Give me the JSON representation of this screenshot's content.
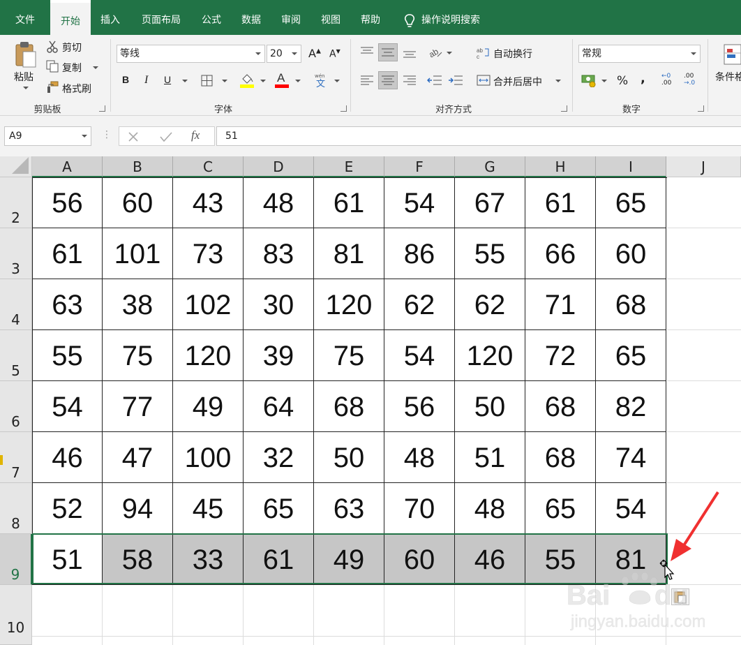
{
  "menu": {
    "tabs": [
      "文件",
      "开始",
      "插入",
      "页面布局",
      "公式",
      "数据",
      "审阅",
      "视图",
      "帮助"
    ],
    "search": "操作说明搜索"
  },
  "ribbon": {
    "clipboard": {
      "paste": "粘贴",
      "cut": "剪切",
      "copy": "复制",
      "format_painter": "格式刷",
      "label": "剪贴板"
    },
    "font": {
      "name": "等线",
      "size": "20",
      "label": "字体",
      "fill_color": "#ffff00",
      "font_color": "#ff0000"
    },
    "alignment": {
      "wrap_text": "自动换行",
      "merge_center": "合并后居中",
      "label": "对齐方式"
    },
    "number": {
      "format": "常规",
      "percent": "%",
      "comma": ",",
      "label": "数字",
      "inc_decimal_a": "←0",
      "inc_decimal_b": ".00",
      "dec_decimal_a": ".00",
      "dec_decimal_b": "→.0"
    },
    "styles": {
      "conditional_format": "条件格"
    }
  },
  "formula_bar": {
    "name_box": "A9",
    "fx": "fx",
    "value": "51"
  },
  "sheet": {
    "columns": [
      "A",
      "B",
      "C",
      "D",
      "E",
      "F",
      "G",
      "H",
      "I",
      "J"
    ],
    "rows": [
      {
        "num": "2",
        "cells": [
          "56",
          "60",
          "43",
          "48",
          "61",
          "54",
          "67",
          "61",
          "65"
        ]
      },
      {
        "num": "3",
        "cells": [
          "61",
          "101",
          "73",
          "83",
          "81",
          "86",
          "55",
          "66",
          "60"
        ]
      },
      {
        "num": "4",
        "cells": [
          "63",
          "38",
          "102",
          "30",
          "120",
          "62",
          "62",
          "71",
          "68"
        ]
      },
      {
        "num": "5",
        "cells": [
          "55",
          "75",
          "120",
          "39",
          "75",
          "54",
          "120",
          "72",
          "65"
        ]
      },
      {
        "num": "6",
        "cells": [
          "54",
          "77",
          "49",
          "64",
          "68",
          "56",
          "50",
          "68",
          "82"
        ]
      },
      {
        "num": "7",
        "cells": [
          "46",
          "47",
          "100",
          "32",
          "50",
          "48",
          "51",
          "68",
          "74"
        ]
      },
      {
        "num": "8",
        "cells": [
          "52",
          "94",
          "45",
          "65",
          "63",
          "70",
          "48",
          "65",
          "54"
        ]
      },
      {
        "num": "9",
        "cells": [
          "51",
          "58",
          "33",
          "61",
          "49",
          "60",
          "46",
          "55",
          "81"
        ]
      }
    ],
    "empty_row": "10",
    "selected_row": "9",
    "accent": "#217346",
    "selection_fill": "#c6c6c6"
  },
  "overlay": {
    "arrow_color": "#f03030"
  }
}
